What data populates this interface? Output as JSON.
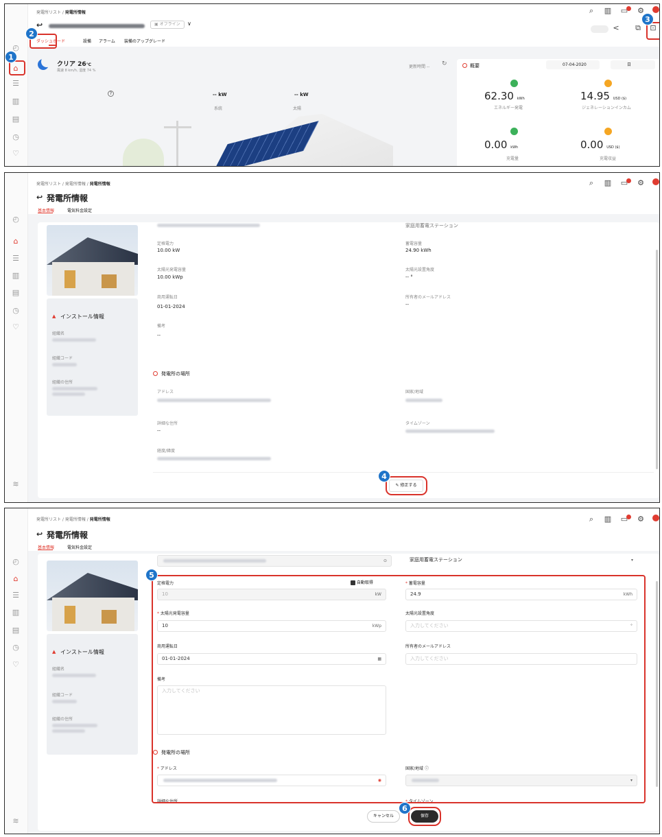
{
  "colors": {
    "accent": "#e03c31",
    "step_badge": "#1f74c9",
    "highlight": "#d9322a"
  },
  "steps": [
    "1",
    "2",
    "3",
    "4",
    "5",
    "6"
  ],
  "icons": [
    "back-arrow-icon",
    "search-icon",
    "building-icon",
    "message-icon",
    "settings-icon",
    "avatar",
    "share-icon",
    "export-icon",
    "moon-icon",
    "refresh-icon",
    "calendar-icon",
    "location-icon",
    "checkbox-icon"
  ],
  "panel1": {
    "breadcrumb_parent": "発電所リスト",
    "breadcrumb_current": "発電所情報",
    "status": "オフライン",
    "tabs": [
      "ダッシュボード",
      "設備",
      "アラーム",
      "装備のアップグレード"
    ],
    "weather": {
      "condition": "クリア",
      "temp": "26",
      "temp_unit": "℃",
      "detail": "風速 8 km/h, 湿度 74 %"
    },
    "update_time_label": "更新時間 --",
    "grid_power": "-- kW",
    "grid_label": "系統",
    "solar_power": "-- kW",
    "solar_label": "太陽",
    "overview_title": "概要",
    "date": "07-04-2020",
    "period": "日",
    "energy_value": "62.30",
    "energy_unit": "kWh",
    "energy_label": "エネルギー発電",
    "income_value": "14.95",
    "income_unit": "USD ($)",
    "income_label": "ジェネレーションインカム",
    "charge_value": "0.00",
    "charge_unit": "kWh",
    "charge_label": "充電量",
    "cost_value": "0.00",
    "cost_unit": "USD ($)",
    "cost_label": "充電収益",
    "help_mark": "?"
  },
  "panel2": {
    "breadcrumb_a": "発電所リスト",
    "breadcrumb_b": "発電所情報",
    "breadcrumb_c": "発電所情報",
    "title": "発電所情報",
    "tabs": [
      "基本情報",
      "電気料金設定"
    ],
    "top_right_value": "家庭用蓄電ステーション",
    "rated_power_label": "定格電力",
    "rated_power": "10.00 kW",
    "capacity_label": "蓄電容量",
    "capacity": "24.90 kWh",
    "pv_capacity_label": "太陽光発電容量",
    "pv_capacity": "10.00 kWp",
    "pv_angle_label": "太陽光設置角度",
    "pv_angle": "-- °",
    "start_date_label": "商用運転日",
    "start_date": "01-01-2024",
    "owner_email_label": "所有者のメールアドレス",
    "owner_email": "--",
    "remark_label": "備考",
    "remark": "--",
    "install_title": "インストール情報",
    "org_name_label": "組織名",
    "org_code_label": "組織コード",
    "org_address_label": "組織の住所",
    "location_title": "発電所の場所",
    "address_label": "アドレス",
    "country_label": "国家/地域",
    "detail_address_label": "詳細な住所",
    "detail_address": "--",
    "timezone_label": "タイムゾーン",
    "latlng_label": "経度/緯度",
    "modify_button": "修正する"
  },
  "panel3": {
    "title": "発電所情報",
    "tabs": [
      "基本情報",
      "電気料金設定"
    ],
    "top_right_select": "家庭用蓄電ステーション",
    "rated_power_label": "定格電力",
    "auto_fetch": "自動取得",
    "rated_power_value": "10",
    "rated_power_unit": "kW",
    "capacity_label": "蓄電容量",
    "capacity_value": "24.9",
    "capacity_unit": "kWh",
    "pv_capacity_label": "太陽光発電容量",
    "pv_capacity_value": "10",
    "pv_capacity_unit": "kWp",
    "pv_angle_label": "太陽光設置角度",
    "pv_angle_placeholder": "入力してください",
    "pv_angle_unit": "°",
    "start_date_label": "商用運転日",
    "start_date_value": "01-01-2024",
    "owner_email_label": "所有者のメールアドレス",
    "owner_email_placeholder": "入力してください",
    "remark_label": "備考",
    "remark_placeholder": "入力してください",
    "install_title": "インストール情報",
    "org_name_label": "組織名",
    "org_code_label": "組織コード",
    "org_address_label": "組織の住所",
    "location_title": "発電所の場所",
    "address_label": "アドレス",
    "country_label": "国家/地域",
    "detail_address_label": "詳細な住所",
    "timezone_label": "タイムゾーン",
    "cancel_button": "キャンセル",
    "save_button": "保存"
  }
}
